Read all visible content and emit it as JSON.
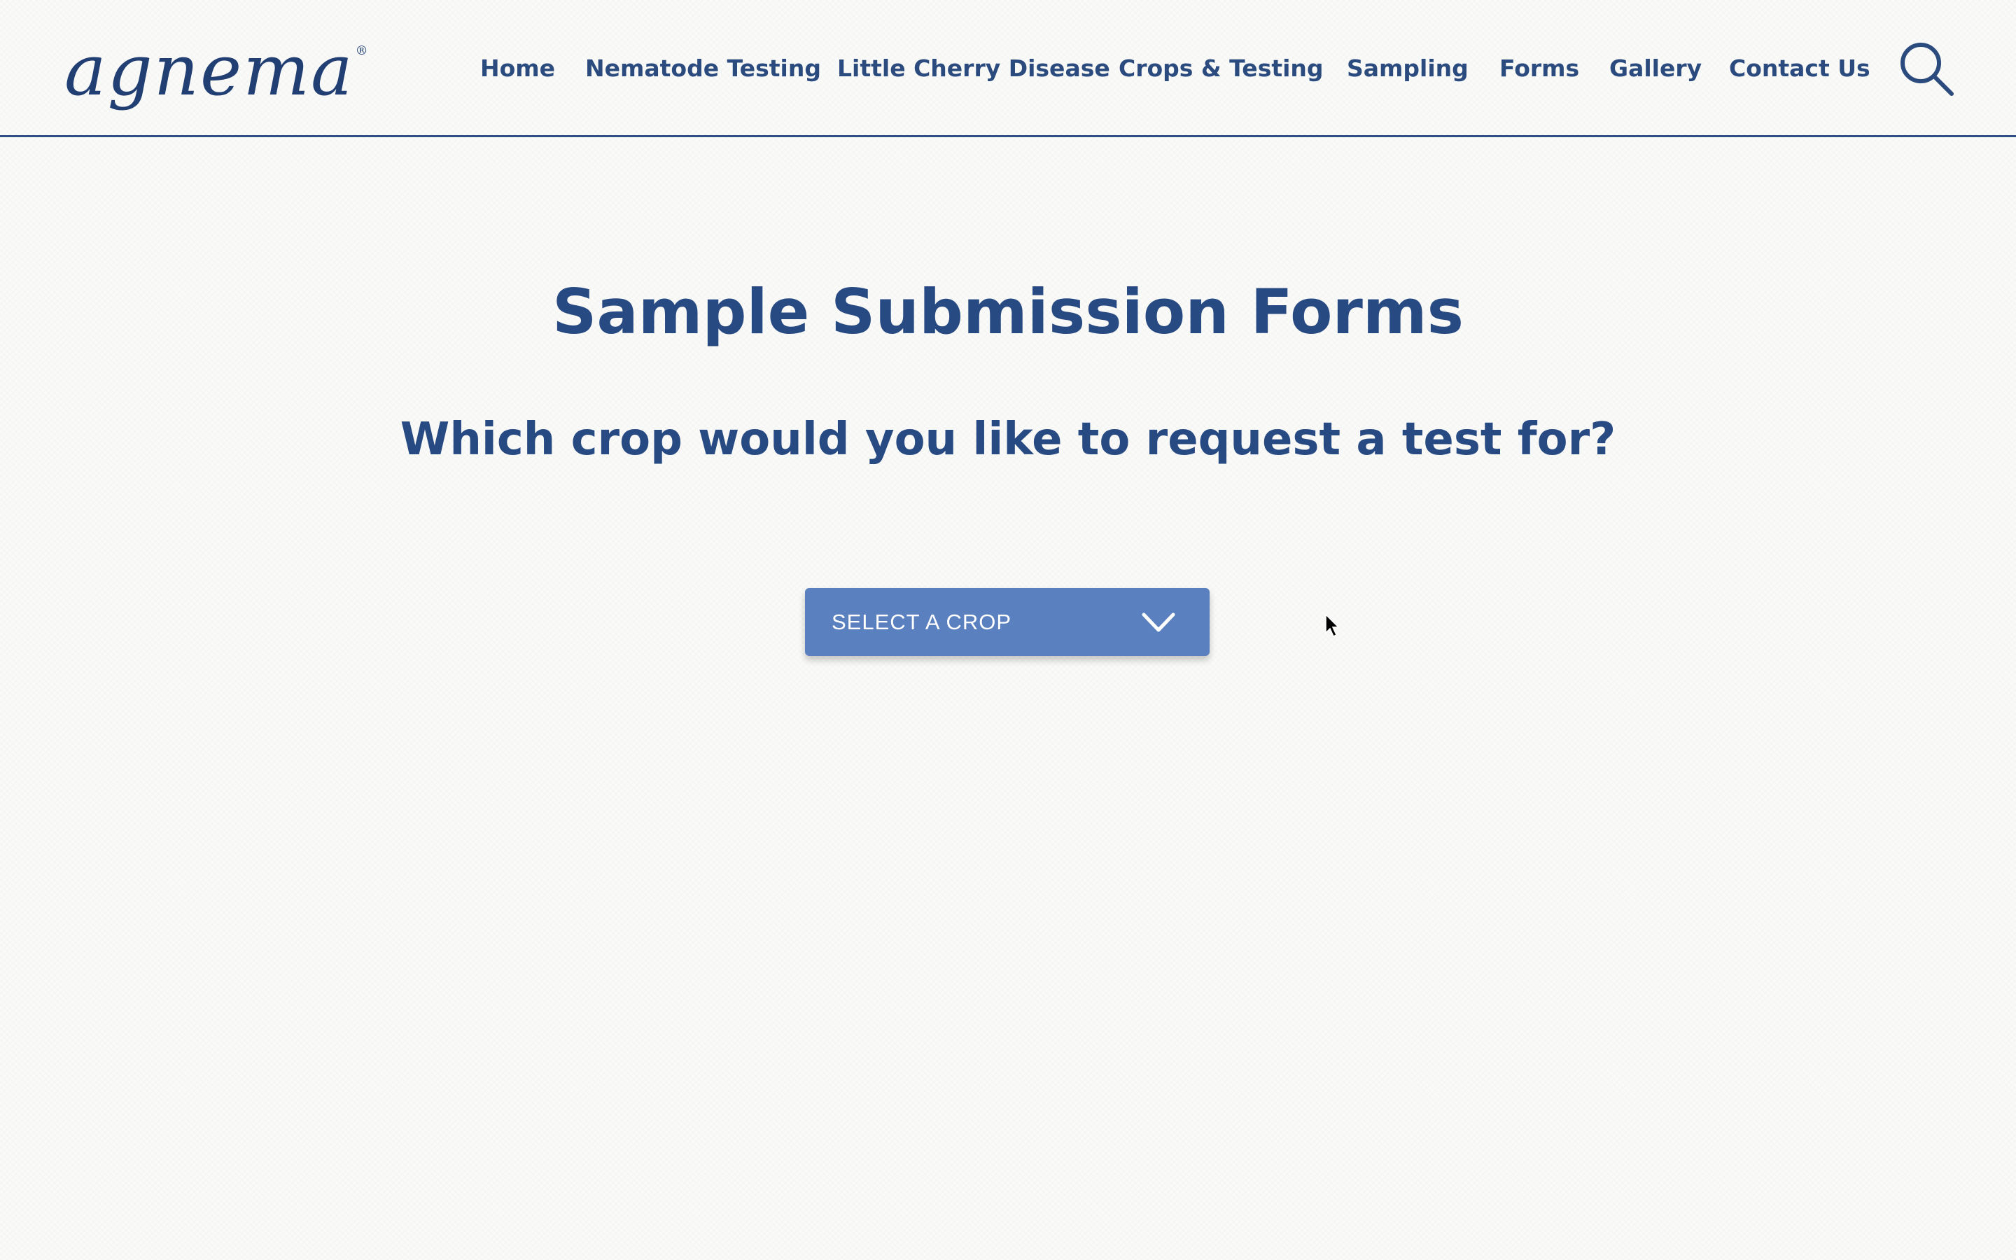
{
  "header": {
    "logo_text": "agnema",
    "logo_registered": "®",
    "nav": [
      {
        "label": "Home"
      },
      {
        "label": "Nematode Testing"
      },
      {
        "label": "Little Cherry Disease"
      },
      {
        "label": "Crops & Testing"
      },
      {
        "label": "Sampling"
      },
      {
        "label": "Forms"
      },
      {
        "label": "Gallery"
      },
      {
        "label": "Contact Us"
      }
    ],
    "search_icon": "search-icon"
  },
  "main": {
    "title": "Sample Submission Forms",
    "question": "Which crop would you like to request a test for?",
    "crop_select": {
      "label": "SELECT A CROP",
      "icon": "chevron-down-icon"
    }
  },
  "colors": {
    "brand_blue": "#284a82",
    "nav_blue": "#2b4b7e",
    "button_blue": "#5b80bf",
    "header_rule": "#2d4f86",
    "background": "#fafaf9"
  }
}
